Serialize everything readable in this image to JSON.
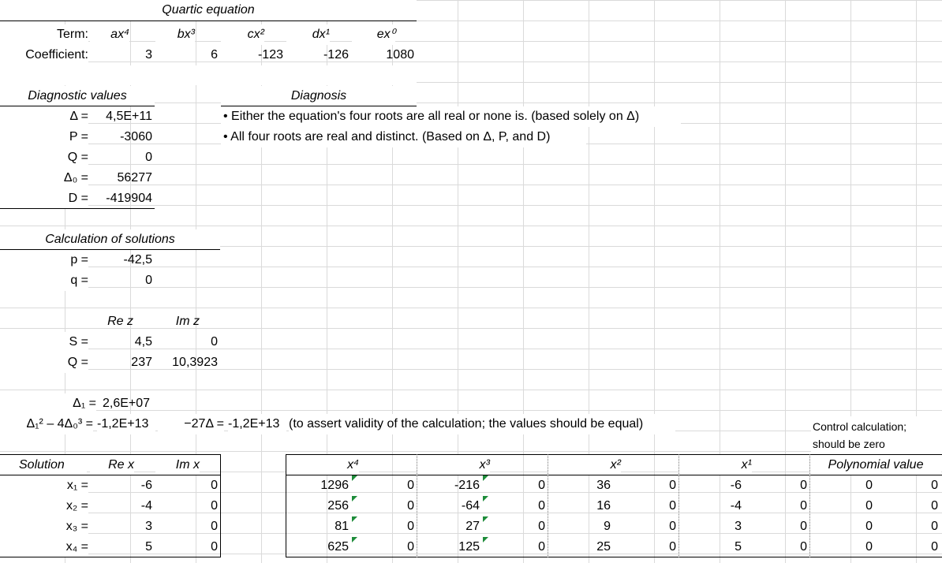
{
  "title": "Quartic equation",
  "terms": {
    "label": "Term:",
    "items": [
      "ax⁴",
      "bx³",
      "cx²",
      "dx¹",
      "ex⁰"
    ]
  },
  "coefficients": {
    "label": "Coefficient:",
    "values": [
      "3",
      "6",
      "-123",
      "-126",
      "1080"
    ]
  },
  "diagnostics": {
    "title": "Diagnostic values",
    "rows": [
      {
        "label": "Δ =",
        "value": "4,5E+11"
      },
      {
        "label": "P =",
        "value": "-3060"
      },
      {
        "label": "Q =",
        "value": "0"
      },
      {
        "label": "Δ₀ =",
        "value": "56277"
      },
      {
        "label": "D =",
        "value": "-419904"
      }
    ]
  },
  "diagnosis": {
    "title": "Diagnosis",
    "lines": [
      "• Either the equation's four roots are all real or none is. (based solely on Δ)",
      "• All four roots are real and distinct. (Based on Δ, P, and D)"
    ]
  },
  "calc": {
    "title": "Calculation of solutions",
    "p": {
      "label": "p =",
      "value": "-42,5"
    },
    "q": {
      "label": "q =",
      "value": "0"
    },
    "re_header": "Re z",
    "im_header": "Im z",
    "S": {
      "label": "S =",
      "re": "4,5",
      "im": "0"
    },
    "Q": {
      "label": "Q =",
      "re": "237",
      "im": "10,3923"
    },
    "delta1": {
      "label": "Δ₁ =",
      "value": "2,6E+07"
    },
    "check": {
      "label": "Δ₁² – 4Δ₀³ =",
      "value": "-1,2E+13",
      "label2": "−27Δ =",
      "value2": "-1,2E+13",
      "note": "(to assert validity of the calculation; the values should be equal)"
    }
  },
  "control": {
    "line1": "Control calculation;",
    "line2": "should be zero",
    "header": "Polynomial value"
  },
  "solutions": {
    "headers": {
      "solution": "Solution",
      "re": "Re x",
      "im": "Im x"
    },
    "powers": [
      "x⁴",
      "x³",
      "x²",
      "x¹"
    ],
    "rows": [
      {
        "label": "x₁ =",
        "re": "-6",
        "im": "0",
        "p4": "1296",
        "p4i": "0",
        "p3": "-216",
        "p3i": "0",
        "p2": "36",
        "p2i": "0",
        "p1": "-6",
        "p1i": "0",
        "pv": "0",
        "pvi": "0"
      },
      {
        "label": "x₂ =",
        "re": "-4",
        "im": "0",
        "p4": "256",
        "p4i": "0",
        "p3": "-64",
        "p3i": "0",
        "p2": "16",
        "p2i": "0",
        "p1": "-4",
        "p1i": "0",
        "pv": "0",
        "pvi": "0"
      },
      {
        "label": "x₃ =",
        "re": "3",
        "im": "0",
        "p4": "81",
        "p4i": "0",
        "p3": "27",
        "p3i": "0",
        "p2": "9",
        "p2i": "0",
        "p1": "3",
        "p1i": "0",
        "pv": "0",
        "pvi": "0"
      },
      {
        "label": "x₄ =",
        "re": "5",
        "im": "0",
        "p4": "625",
        "p4i": "0",
        "p3": "125",
        "p3i": "0",
        "p2": "25",
        "p2i": "0",
        "p1": "5",
        "p1i": "0",
        "pv": "0",
        "pvi": "0"
      }
    ]
  }
}
